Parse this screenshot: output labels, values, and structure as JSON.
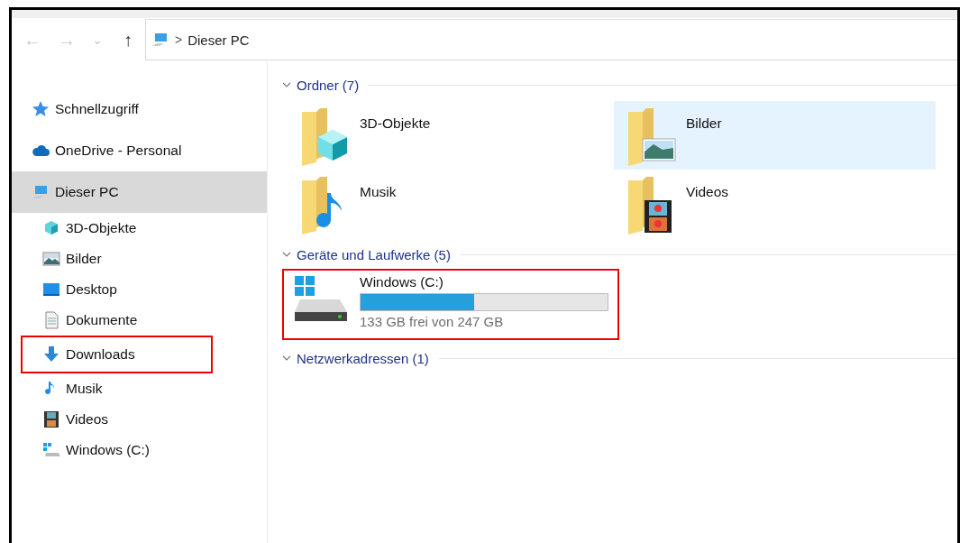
{
  "toolbar": {
    "back": "←",
    "forward": "→",
    "recent": "⌄",
    "up": "↑",
    "separator": ">",
    "path": "Dieser PC"
  },
  "sidebar": {
    "items": [
      {
        "kind": "quick",
        "label": "Schnellzugriff",
        "selected": false,
        "highlighted": false
      },
      {
        "kind": "cloud",
        "label": "OneDrive - Personal",
        "selected": false,
        "highlighted": false
      },
      {
        "kind": "pc",
        "label": "Dieser PC",
        "selected": true,
        "highlighted": false,
        "children": [
          {
            "kind": "objects",
            "label": "3D-Objekte",
            "selected": false,
            "highlighted": false
          },
          {
            "kind": "pictures",
            "label": "Bilder",
            "selected": false,
            "highlighted": false
          },
          {
            "kind": "desktop",
            "label": "Desktop",
            "selected": false,
            "highlighted": false
          },
          {
            "kind": "documents",
            "label": "Dokumente",
            "selected": false,
            "highlighted": false
          },
          {
            "kind": "downloads",
            "label": "Downloads",
            "selected": false,
            "highlighted": true
          },
          {
            "kind": "music",
            "label": "Musik",
            "selected": false,
            "highlighted": false
          },
          {
            "kind": "videos",
            "label": "Videos",
            "selected": false,
            "highlighted": false
          },
          {
            "kind": "drive",
            "label": "Windows (C:)",
            "selected": false,
            "highlighted": false
          }
        ]
      }
    ]
  },
  "groups": [
    {
      "title": "Ordner (7)",
      "expanded": true,
      "items": [
        {
          "kind": "objects",
          "label": "3D-Objekte",
          "selected": false,
          "highlighted": false
        },
        {
          "kind": "pictures",
          "label": "Bilder",
          "selected": true,
          "highlighted": false
        },
        {
          "kind": "music",
          "label": "Musik",
          "selected": false,
          "highlighted": false
        },
        {
          "kind": "videos",
          "label": "Videos",
          "selected": false,
          "highlighted": false
        }
      ]
    },
    {
      "title": "Geräte und Laufwerke (5)",
      "expanded": true,
      "items": [
        {
          "kind": "drive",
          "label": "Windows (C:)",
          "level": 0.46,
          "detail": "133 GB frei von 247 GB",
          "selected": false,
          "highlighted": true
        }
      ]
    },
    {
      "title": "Netzwerkadressen (1)",
      "expanded": true
    }
  ]
}
